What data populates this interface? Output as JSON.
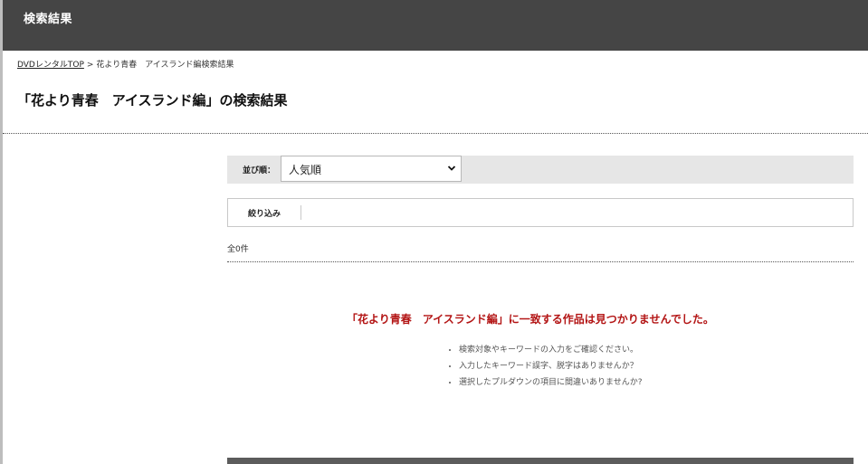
{
  "header": {
    "title": "検索結果"
  },
  "breadcrumb": {
    "home": "DVDレンタルTOP",
    "separator": ">",
    "current": "花より青春　アイスランド編検索結果"
  },
  "page_title": "「花より青春　アイスランド編」の検索結果",
  "sort": {
    "label": "並び順：",
    "selected": "人気順",
    "icon": "chevron-down-icon"
  },
  "filter": {
    "label": "絞り込み"
  },
  "result_count": "全0件",
  "no_result_message": "「花より青春　アイスランド編」に一致する作品は見つかりませんでした。",
  "tips": [
    "検索対象やキーワードの入力をご確認ください。",
    "入力したキーワード誤字、脱字はありませんか？",
    "選択したプルダウンの項目に間違いありませんか?"
  ],
  "colors": {
    "header_bg": "#454545",
    "error_text": "#b31414",
    "sort_bar_bg": "#e6e6e6"
  }
}
